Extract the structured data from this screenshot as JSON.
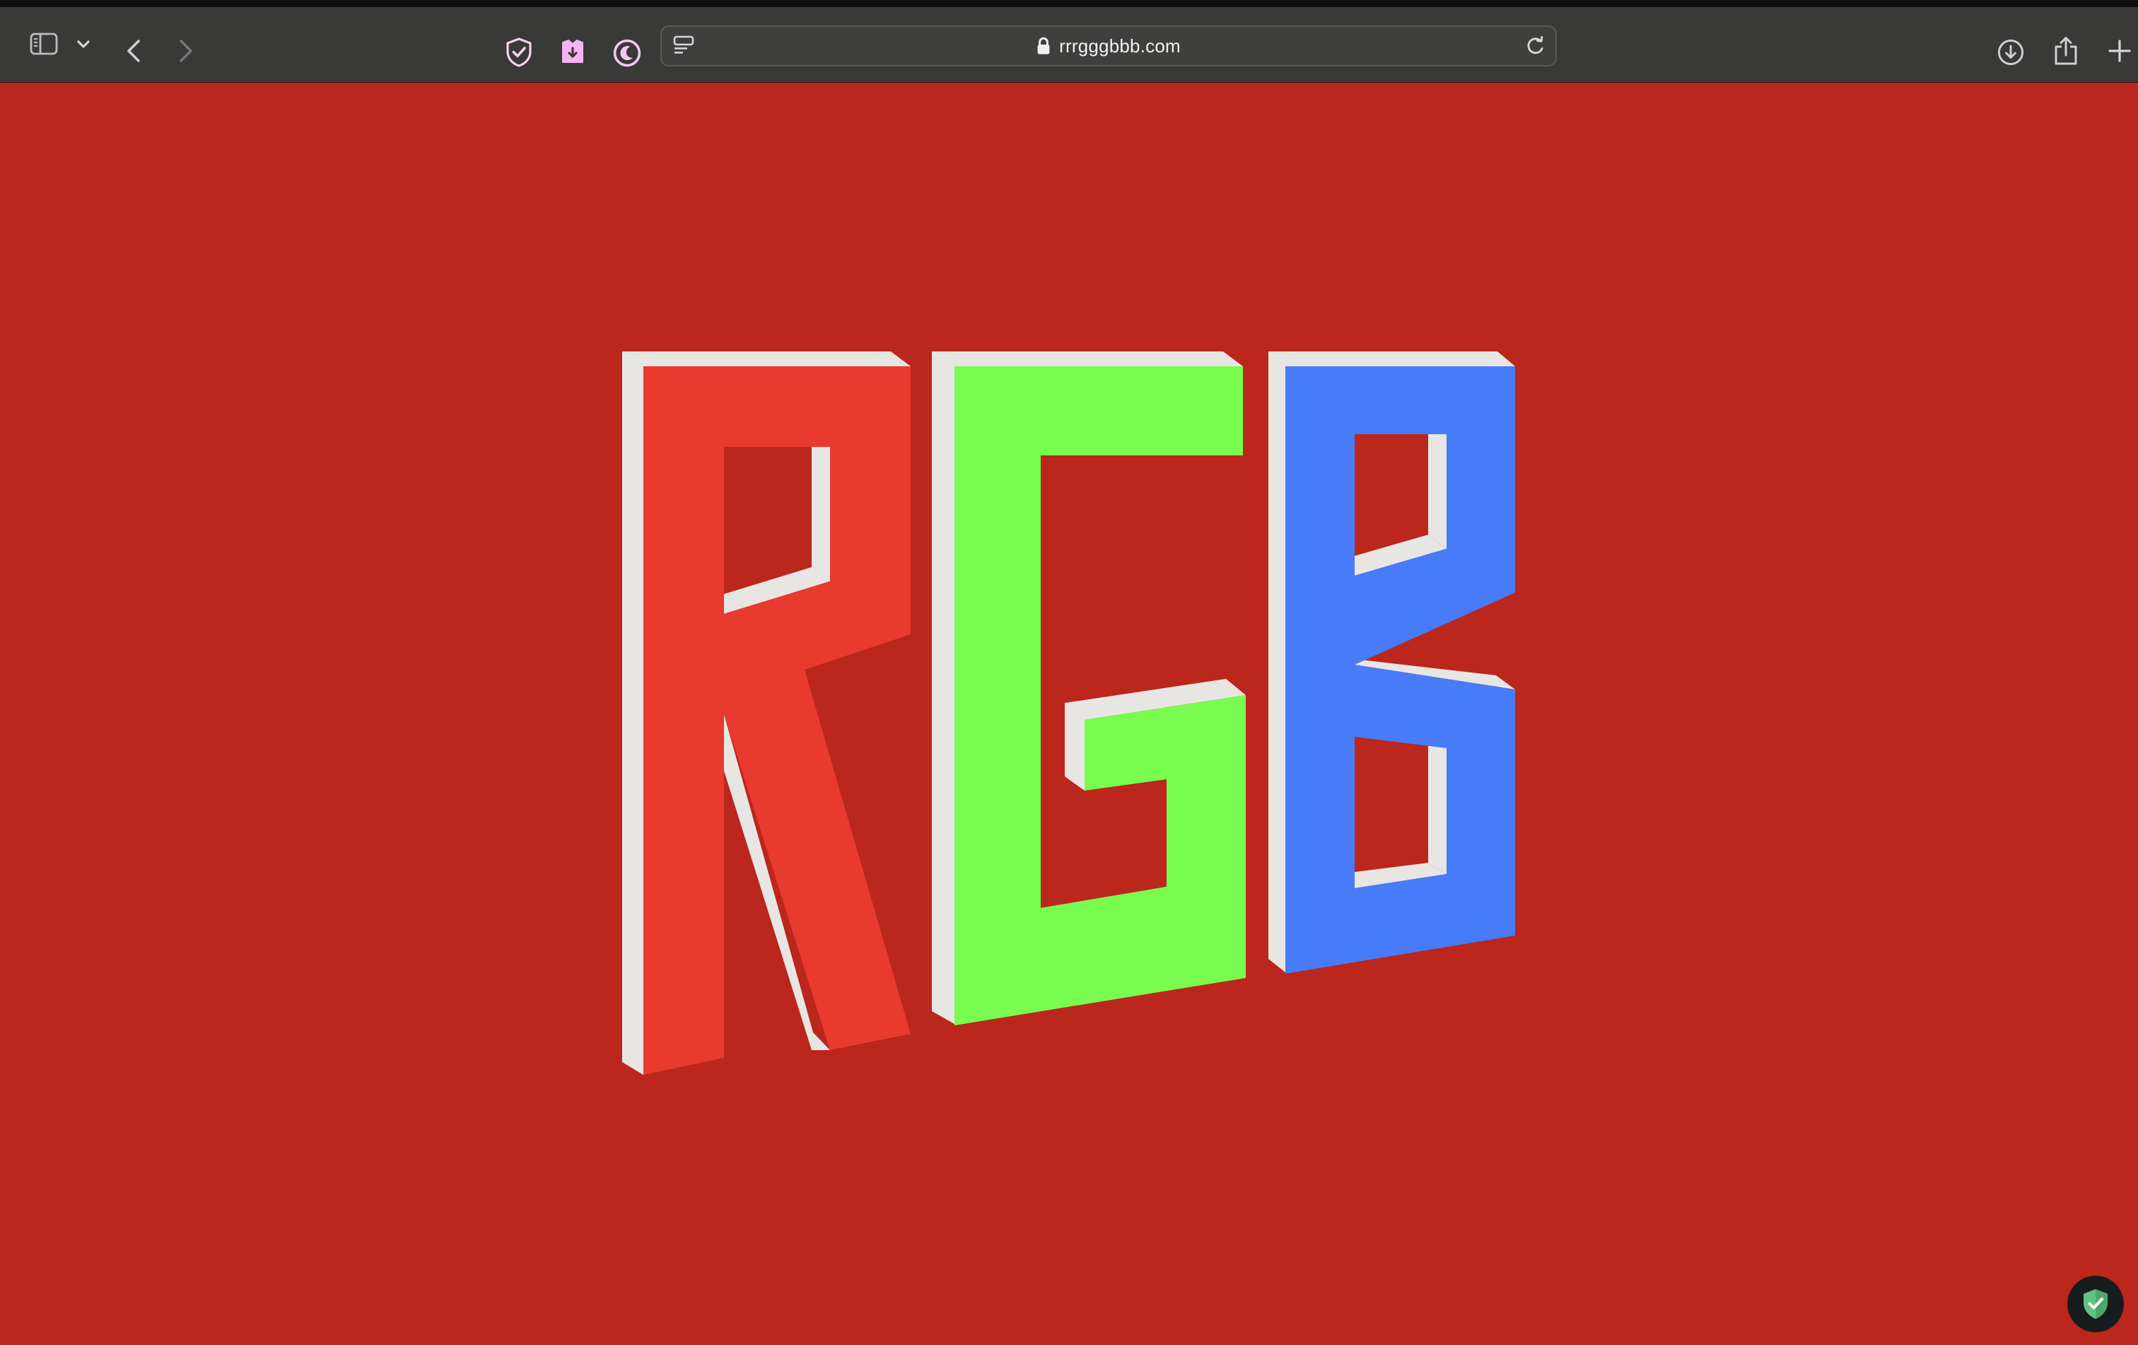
{
  "browser": {
    "address_bar": {
      "url": "rrrgggbbb.com"
    },
    "toolbar_icons": [
      "sidebar-icon",
      "chevron-down-icon",
      "back-icon",
      "forward-icon",
      "privacy-shield-icon",
      "extension-icon",
      "night-mode-icon",
      "page-menu-icon",
      "lock-icon",
      "reload-icon",
      "download-icon",
      "share-icon",
      "new-tab-icon",
      "tab-overview-icon"
    ]
  },
  "page": {
    "background_color": "#bb261d",
    "logo": {
      "letters": [
        "R",
        "G",
        "B"
      ],
      "colors": {
        "R": "#e83a2f",
        "G": "#79fc50",
        "B": "#477bf7",
        "side": "#e8e6e3"
      }
    },
    "badge_icon": "shield-check-icon"
  }
}
